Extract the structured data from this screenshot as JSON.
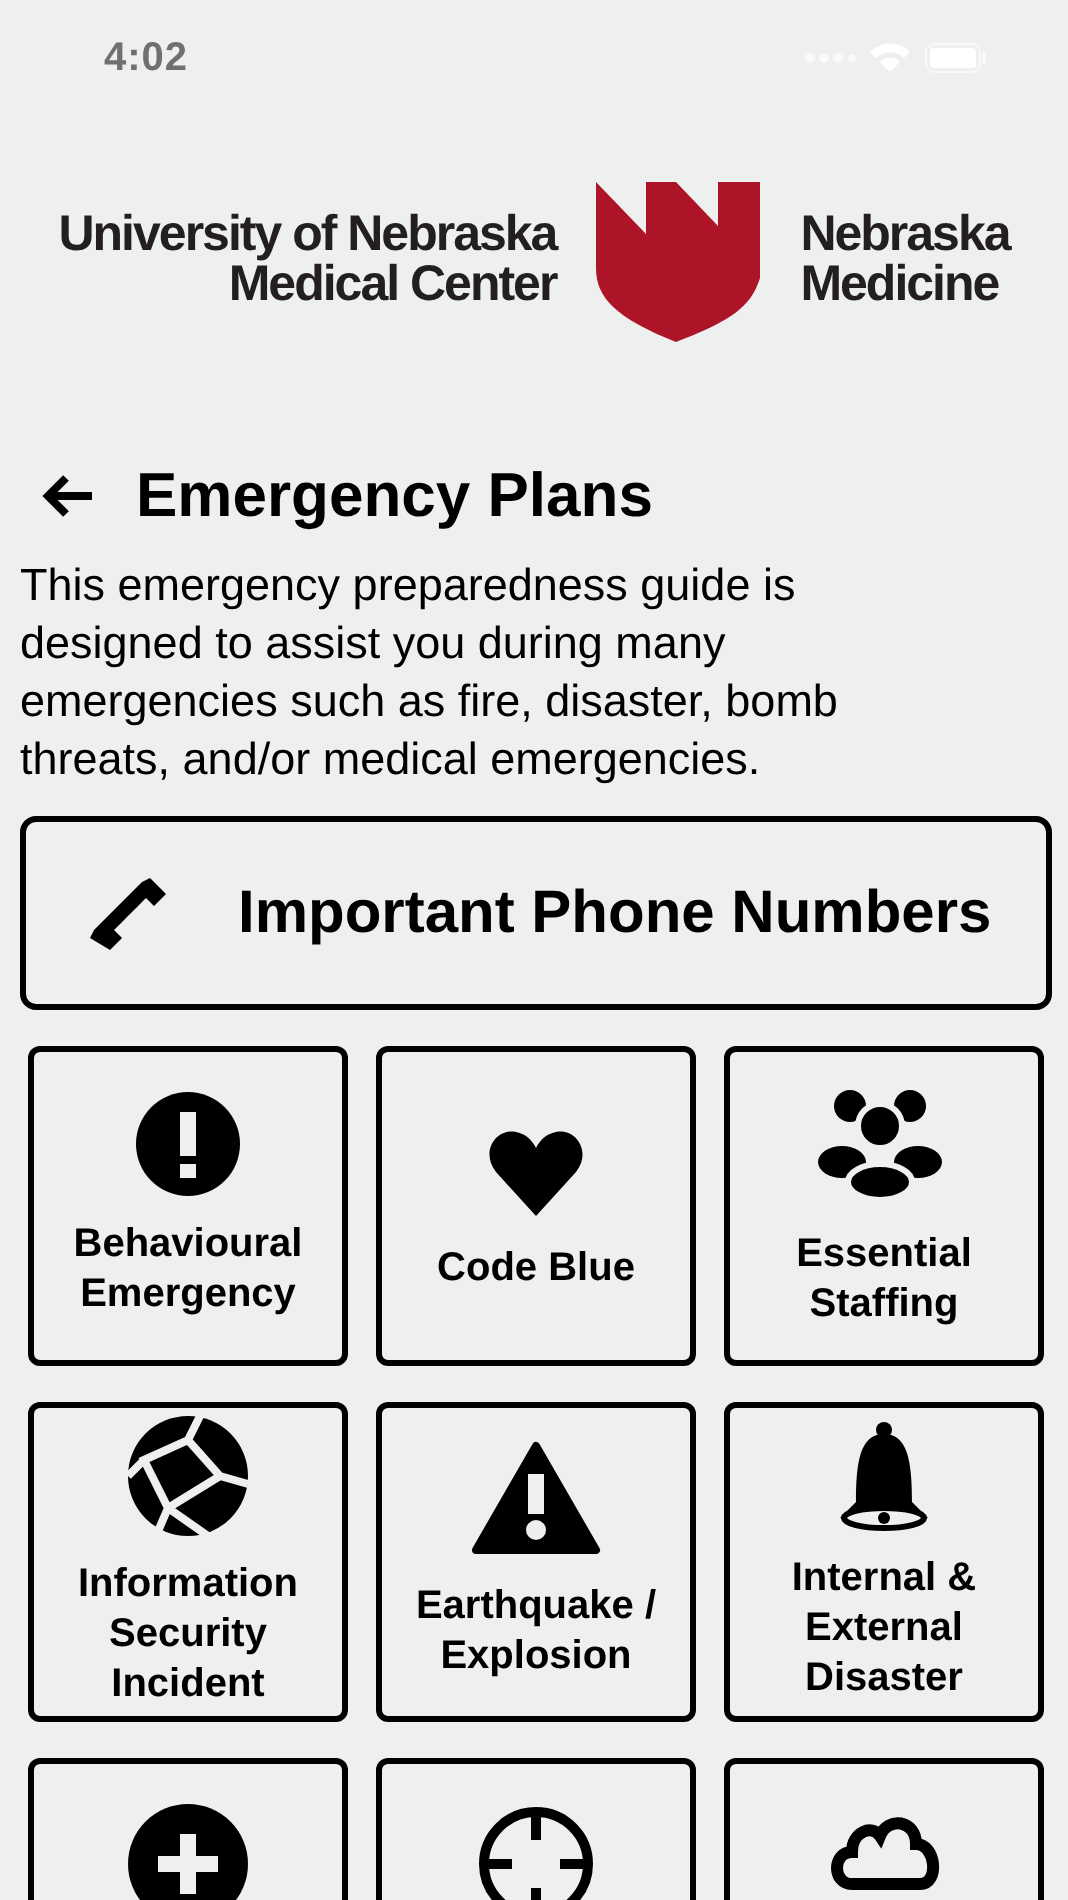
{
  "status_bar": {
    "time": "4:02"
  },
  "logo": {
    "left_lines": [
      "University of Nebraska",
      "Medical Center"
    ],
    "right_lines": [
      "Nebraska",
      "Medicine"
    ]
  },
  "header": {
    "title": "Emergency Plans"
  },
  "description": "This emergency preparedness guide is designed to assist you during many emergencies such as fire, disaster, bomb threats, and/or medical emergencies.",
  "phone_button": {
    "label": "Important Phone Numbers"
  },
  "tiles": [
    {
      "kind": "alert-circle",
      "label": "Behavioural Emergency"
    },
    {
      "kind": "heart",
      "label": "Code Blue"
    },
    {
      "kind": "people",
      "label": "Essential Staffing"
    },
    {
      "kind": "globe",
      "label": "Information Security Incident"
    },
    {
      "kind": "warning",
      "label": "Earthquake / Explosion"
    },
    {
      "kind": "bell",
      "label": "Internal & External Disaster"
    },
    {
      "kind": "plus-circle"
    },
    {
      "kind": "crosshair"
    },
    {
      "kind": "cloud"
    }
  ]
}
